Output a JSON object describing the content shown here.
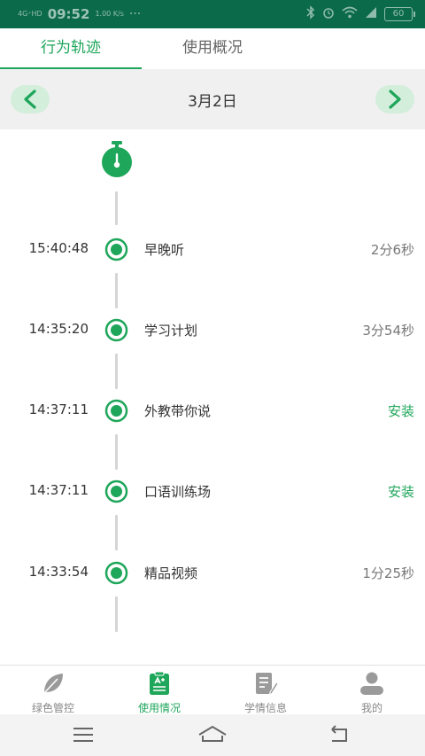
{
  "status_bar": {
    "network": "4G⁺HD",
    "time": "09:52",
    "speed": "1.00 K/s",
    "more": "···",
    "battery": "60"
  },
  "tabs": [
    {
      "label": "行为轨迹",
      "active": true
    },
    {
      "label": "使用概况",
      "active": false
    }
  ],
  "date_bar": {
    "date": "3月2日",
    "prev_icon": "chevron-left-icon",
    "next_icon": "chevron-right-icon"
  },
  "timeline": {
    "entries": [
      {
        "time": "15:40:48",
        "app": "早晚听",
        "duration": "2分6秒",
        "is_install": false
      },
      {
        "time": "14:35:20",
        "app": "学习计划",
        "duration": "3分54秒",
        "is_install": false
      },
      {
        "time": "14:37:11",
        "app": "外教带你说",
        "duration": "安装",
        "is_install": true
      },
      {
        "time": "14:37:11",
        "app": "口语训练场",
        "duration": "安装",
        "is_install": true
      },
      {
        "time": "14:33:54",
        "app": "精品视频",
        "duration": "1分25秒",
        "is_install": false
      }
    ]
  },
  "bottom_nav": [
    {
      "label": "绿色管控",
      "icon": "leaf-icon",
      "active": false
    },
    {
      "label": "使用情况",
      "icon": "clipboard-icon",
      "active": true
    },
    {
      "label": "学情信息",
      "icon": "document-edit-icon",
      "active": false
    },
    {
      "label": "我的",
      "icon": "person-icon",
      "active": false
    }
  ],
  "colors": {
    "accent": "#1ea65a",
    "status_bar_bg": "#0b6a4a",
    "date_bar_bg": "#f0f0f0",
    "nav_btn_bg": "#d4eedc"
  }
}
